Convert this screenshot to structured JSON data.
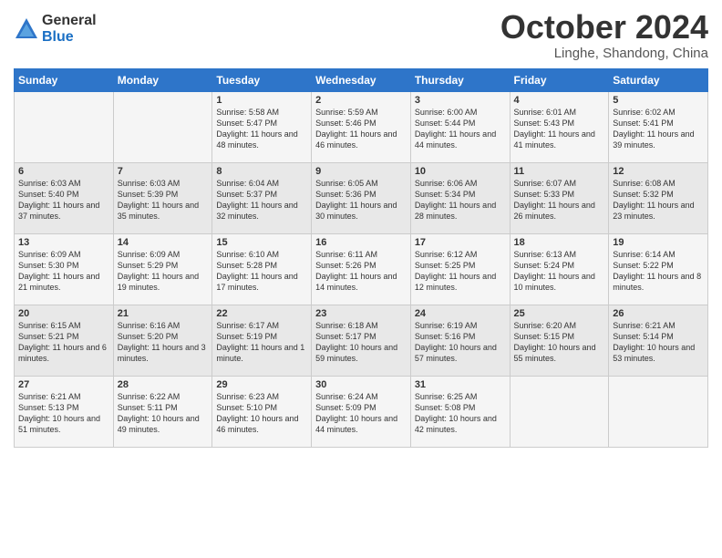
{
  "header": {
    "logo_general": "General",
    "logo_blue": "Blue",
    "month_title": "October 2024",
    "location": "Linghe, Shandong, China"
  },
  "days_of_week": [
    "Sunday",
    "Monday",
    "Tuesday",
    "Wednesday",
    "Thursday",
    "Friday",
    "Saturday"
  ],
  "weeks": [
    [
      {
        "day": "",
        "sunrise": "",
        "sunset": "",
        "daylight": ""
      },
      {
        "day": "",
        "sunrise": "",
        "sunset": "",
        "daylight": ""
      },
      {
        "day": "1",
        "sunrise": "Sunrise: 5:58 AM",
        "sunset": "Sunset: 5:47 PM",
        "daylight": "Daylight: 11 hours and 48 minutes."
      },
      {
        "day": "2",
        "sunrise": "Sunrise: 5:59 AM",
        "sunset": "Sunset: 5:46 PM",
        "daylight": "Daylight: 11 hours and 46 minutes."
      },
      {
        "day": "3",
        "sunrise": "Sunrise: 6:00 AM",
        "sunset": "Sunset: 5:44 PM",
        "daylight": "Daylight: 11 hours and 44 minutes."
      },
      {
        "day": "4",
        "sunrise": "Sunrise: 6:01 AM",
        "sunset": "Sunset: 5:43 PM",
        "daylight": "Daylight: 11 hours and 41 minutes."
      },
      {
        "day": "5",
        "sunrise": "Sunrise: 6:02 AM",
        "sunset": "Sunset: 5:41 PM",
        "daylight": "Daylight: 11 hours and 39 minutes."
      }
    ],
    [
      {
        "day": "6",
        "sunrise": "Sunrise: 6:03 AM",
        "sunset": "Sunset: 5:40 PM",
        "daylight": "Daylight: 11 hours and 37 minutes."
      },
      {
        "day": "7",
        "sunrise": "Sunrise: 6:03 AM",
        "sunset": "Sunset: 5:39 PM",
        "daylight": "Daylight: 11 hours and 35 minutes."
      },
      {
        "day": "8",
        "sunrise": "Sunrise: 6:04 AM",
        "sunset": "Sunset: 5:37 PM",
        "daylight": "Daylight: 11 hours and 32 minutes."
      },
      {
        "day": "9",
        "sunrise": "Sunrise: 6:05 AM",
        "sunset": "Sunset: 5:36 PM",
        "daylight": "Daylight: 11 hours and 30 minutes."
      },
      {
        "day": "10",
        "sunrise": "Sunrise: 6:06 AM",
        "sunset": "Sunset: 5:34 PM",
        "daylight": "Daylight: 11 hours and 28 minutes."
      },
      {
        "day": "11",
        "sunrise": "Sunrise: 6:07 AM",
        "sunset": "Sunset: 5:33 PM",
        "daylight": "Daylight: 11 hours and 26 minutes."
      },
      {
        "day": "12",
        "sunrise": "Sunrise: 6:08 AM",
        "sunset": "Sunset: 5:32 PM",
        "daylight": "Daylight: 11 hours and 23 minutes."
      }
    ],
    [
      {
        "day": "13",
        "sunrise": "Sunrise: 6:09 AM",
        "sunset": "Sunset: 5:30 PM",
        "daylight": "Daylight: 11 hours and 21 minutes."
      },
      {
        "day": "14",
        "sunrise": "Sunrise: 6:09 AM",
        "sunset": "Sunset: 5:29 PM",
        "daylight": "Daylight: 11 hours and 19 minutes."
      },
      {
        "day": "15",
        "sunrise": "Sunrise: 6:10 AM",
        "sunset": "Sunset: 5:28 PM",
        "daylight": "Daylight: 11 hours and 17 minutes."
      },
      {
        "day": "16",
        "sunrise": "Sunrise: 6:11 AM",
        "sunset": "Sunset: 5:26 PM",
        "daylight": "Daylight: 11 hours and 14 minutes."
      },
      {
        "day": "17",
        "sunrise": "Sunrise: 6:12 AM",
        "sunset": "Sunset: 5:25 PM",
        "daylight": "Daylight: 11 hours and 12 minutes."
      },
      {
        "day": "18",
        "sunrise": "Sunrise: 6:13 AM",
        "sunset": "Sunset: 5:24 PM",
        "daylight": "Daylight: 11 hours and 10 minutes."
      },
      {
        "day": "19",
        "sunrise": "Sunrise: 6:14 AM",
        "sunset": "Sunset: 5:22 PM",
        "daylight": "Daylight: 11 hours and 8 minutes."
      }
    ],
    [
      {
        "day": "20",
        "sunrise": "Sunrise: 6:15 AM",
        "sunset": "Sunset: 5:21 PM",
        "daylight": "Daylight: 11 hours and 6 minutes."
      },
      {
        "day": "21",
        "sunrise": "Sunrise: 6:16 AM",
        "sunset": "Sunset: 5:20 PM",
        "daylight": "Daylight: 11 hours and 3 minutes."
      },
      {
        "day": "22",
        "sunrise": "Sunrise: 6:17 AM",
        "sunset": "Sunset: 5:19 PM",
        "daylight": "Daylight: 11 hours and 1 minute."
      },
      {
        "day": "23",
        "sunrise": "Sunrise: 6:18 AM",
        "sunset": "Sunset: 5:17 PM",
        "daylight": "Daylight: 10 hours and 59 minutes."
      },
      {
        "day": "24",
        "sunrise": "Sunrise: 6:19 AM",
        "sunset": "Sunset: 5:16 PM",
        "daylight": "Daylight: 10 hours and 57 minutes."
      },
      {
        "day": "25",
        "sunrise": "Sunrise: 6:20 AM",
        "sunset": "Sunset: 5:15 PM",
        "daylight": "Daylight: 10 hours and 55 minutes."
      },
      {
        "day": "26",
        "sunrise": "Sunrise: 6:21 AM",
        "sunset": "Sunset: 5:14 PM",
        "daylight": "Daylight: 10 hours and 53 minutes."
      }
    ],
    [
      {
        "day": "27",
        "sunrise": "Sunrise: 6:21 AM",
        "sunset": "Sunset: 5:13 PM",
        "daylight": "Daylight: 10 hours and 51 minutes."
      },
      {
        "day": "28",
        "sunrise": "Sunrise: 6:22 AM",
        "sunset": "Sunset: 5:11 PM",
        "daylight": "Daylight: 10 hours and 49 minutes."
      },
      {
        "day": "29",
        "sunrise": "Sunrise: 6:23 AM",
        "sunset": "Sunset: 5:10 PM",
        "daylight": "Daylight: 10 hours and 46 minutes."
      },
      {
        "day": "30",
        "sunrise": "Sunrise: 6:24 AM",
        "sunset": "Sunset: 5:09 PM",
        "daylight": "Daylight: 10 hours and 44 minutes."
      },
      {
        "day": "31",
        "sunrise": "Sunrise: 6:25 AM",
        "sunset": "Sunset: 5:08 PM",
        "daylight": "Daylight: 10 hours and 42 minutes."
      },
      {
        "day": "",
        "sunrise": "",
        "sunset": "",
        "daylight": ""
      },
      {
        "day": "",
        "sunrise": "",
        "sunset": "",
        "daylight": ""
      }
    ]
  ]
}
